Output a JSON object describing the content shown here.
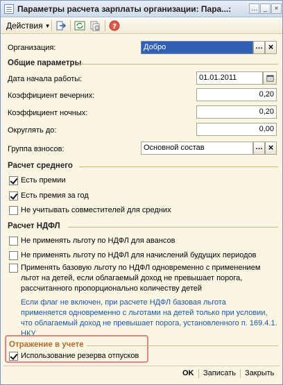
{
  "window": {
    "title": "Параметры расчета зарплаты организации: Пара...:"
  },
  "toolbar": {
    "actions_label": "Действия",
    "icons": [
      "go-to-icon",
      "refresh-icon",
      "copy-icon",
      "help-icon"
    ]
  },
  "org": {
    "label": "Организация:",
    "value": "Добро"
  },
  "general": {
    "header": "Общие параметры",
    "start_date_label": "Дата начала работы:",
    "start_date_value": "01.01.2011",
    "evening_label": "Коэффициент вечерних:",
    "evening_value": "0,20",
    "night_label": "Коэффициент ночных:",
    "night_value": "0,20",
    "round_label": "Округлять до:",
    "round_value": "0,00",
    "group_label": "Группа взносов:",
    "group_value": "Основной состав"
  },
  "average": {
    "header": "Расчет среднего",
    "bonus_label": "Есть премии",
    "bonus_checked": true,
    "yearly_label": "Есть премия за год",
    "yearly_checked": true,
    "combiners_label": "Не учитывать совместителей для средних",
    "combiners_checked": false
  },
  "ndfl": {
    "header": "Расчет НДФЛ",
    "opt1_label": "Не применять льготу по НДФЛ для авансов",
    "opt2_label": "Не применять льготу по НДФЛ для начислений будущих периодов",
    "opt3_line1": "Применять базовую льготу по НДФЛ одновременно с применением",
    "opt3_line2": "льгот на детей, если облагаемый доход не превышает порога,",
    "opt3_line3": "рассчитанного пропорционально количеству детей",
    "note_line1": "Если флаг не включен, при расчете НДФЛ базовая льгота",
    "note_line2": "применяется одновременно с льготами на детей только при условии,",
    "note_line3": "что облагаемый доход не превышает порога, установленного п. 169.4.1.",
    "note_line4": "НКУ"
  },
  "accounting": {
    "header": "Отражение в учете",
    "reserve_label": "Использование резерва отпусков",
    "reserve_checked": true
  },
  "footer": {
    "ok_label": "OK",
    "save_label": "Записать",
    "close_label": "Закрыть"
  }
}
